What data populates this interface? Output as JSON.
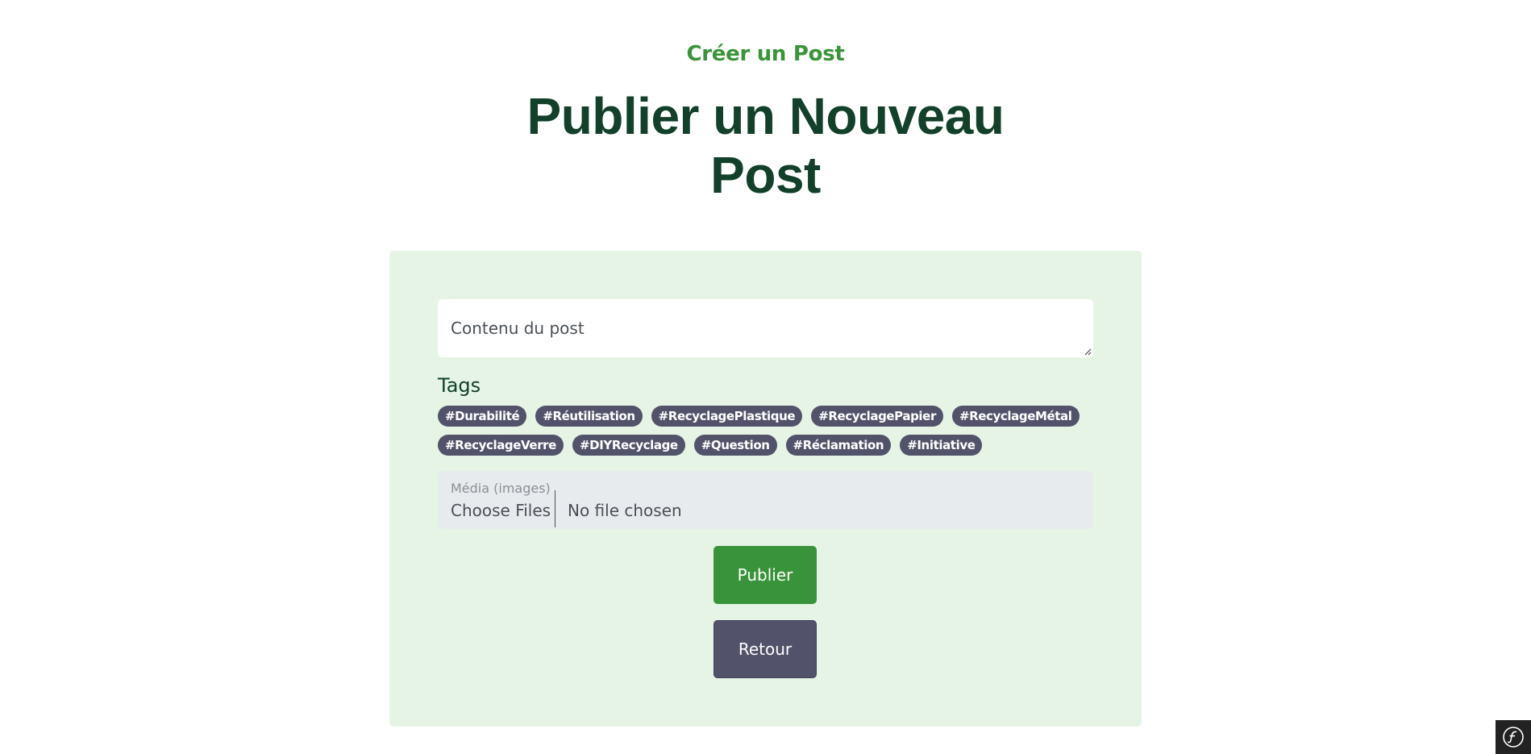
{
  "header": {
    "subtitle": "Créer un Post",
    "title_line1": "Publier un Nouveau",
    "title_line2": "Post"
  },
  "form": {
    "content_placeholder": "Contenu du post",
    "tags_label": "Tags",
    "tags": [
      "#Durabilité",
      "#Réutilisation",
      "#RecyclagePlastique",
      "#RecyclagePapier",
      "#RecyclageMétal",
      "#RecyclageVerre",
      "#DIYRecyclage",
      "#Question",
      "#Réclamation",
      "#Initiative"
    ],
    "media_label": "Média (images)",
    "choose_files_label": "Choose Files",
    "no_file_text": "No file chosen",
    "publish_label": "Publier",
    "back_label": "Retour"
  },
  "colors": {
    "accent_green": "#39933a",
    "title_dark_green": "#12402a",
    "card_background": "#e6f4e6",
    "tag_background": "#52526a",
    "back_button": "#52526a"
  },
  "toolbar": {
    "icon": "symfony-icon"
  }
}
